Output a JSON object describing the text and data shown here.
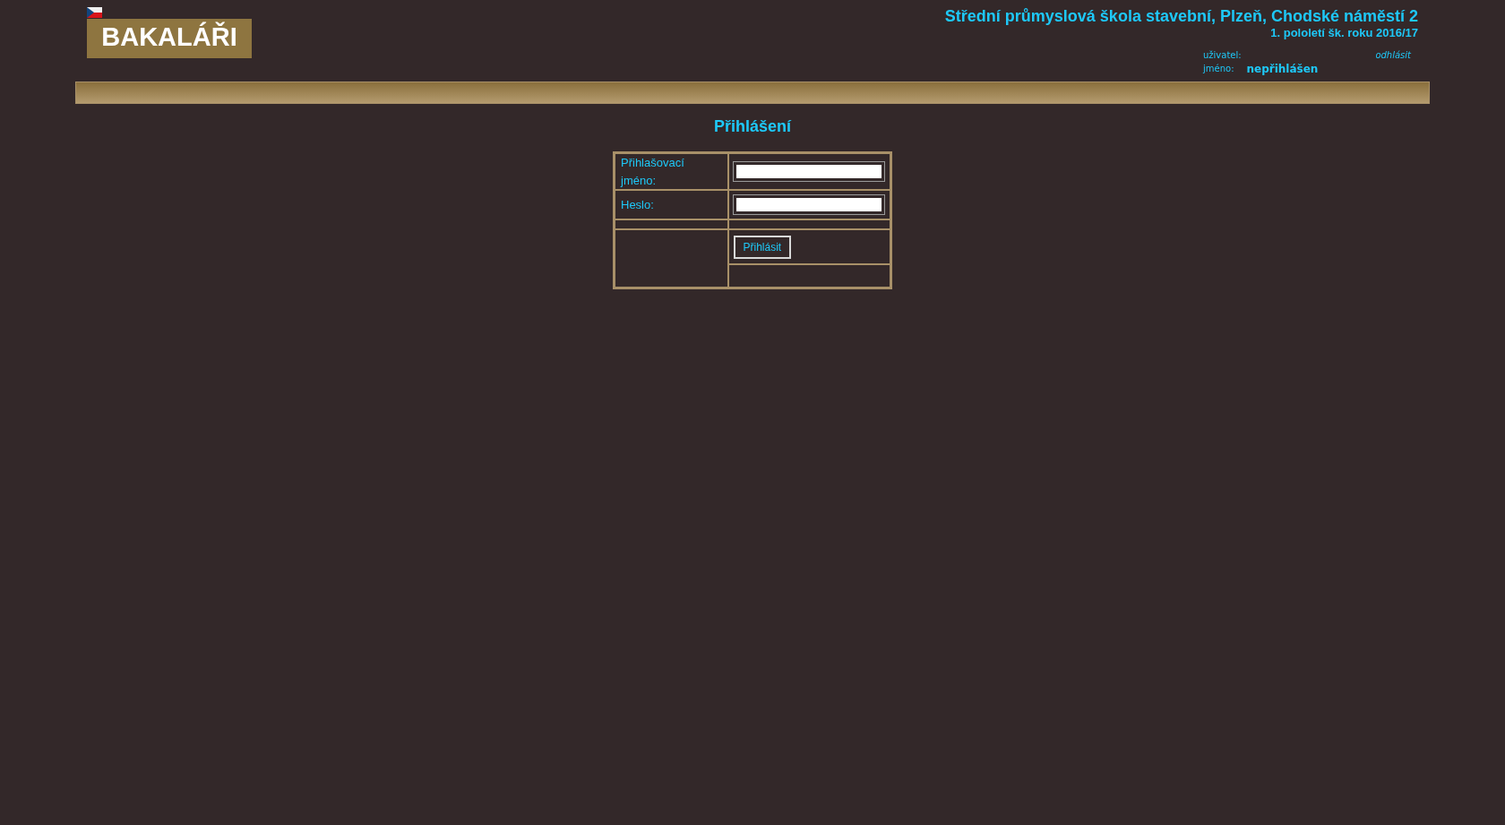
{
  "header": {
    "logo": "BAKALÁŘI",
    "school": "Střední průmyslová škola stavební, Plzeň, Chodské náměstí 2",
    "term": "1. pololetí šk. roku 2016/17"
  },
  "user": {
    "user_label": "uživatel:",
    "logout": "odhlásit",
    "name_label": "jméno:",
    "name": "nepřihlášen"
  },
  "login": {
    "title": "Přihlášení",
    "username_label": "Přihlašovací jméno:",
    "password_label": "Heslo:",
    "submit": "Přihlásit"
  }
}
